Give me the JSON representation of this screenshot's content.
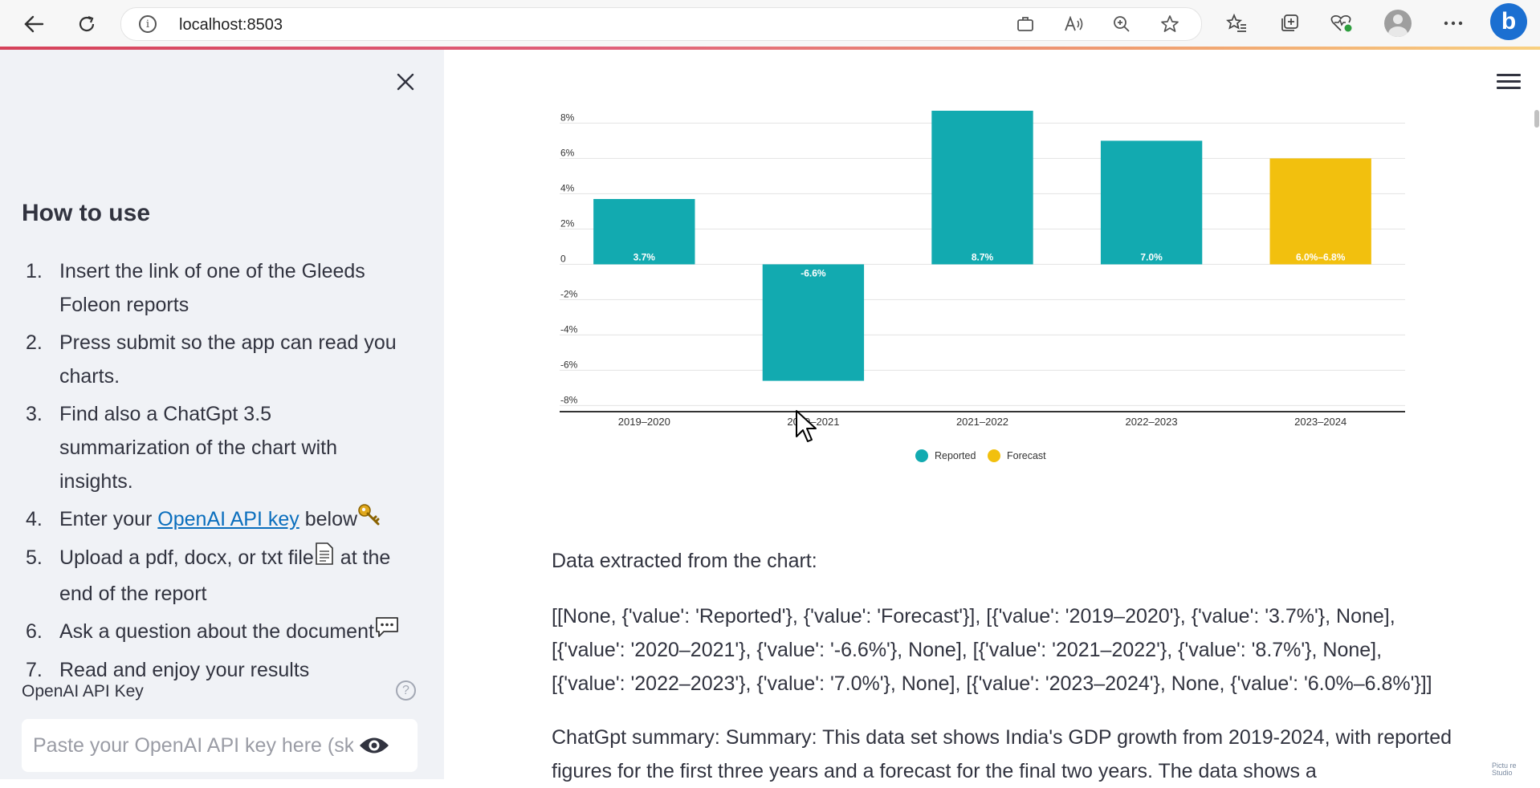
{
  "browser": {
    "url": "localhost:8503"
  },
  "sidebar": {
    "title": "How to use",
    "steps": [
      {
        "num": "1.",
        "text": "Insert the link of one of the Gleeds Foleon reports"
      },
      {
        "num": "2.",
        "text": "Press submit so the app can read you charts."
      },
      {
        "num": "3.",
        "text": "Find also a ChatGpt 3.5 summarization of the chart with insights."
      },
      {
        "num": "4.",
        "pre": "Enter your ",
        "link": "OpenAI API key",
        "post": " below"
      },
      {
        "num": "5.",
        "pre": "Upload a pdf, docx, or txt file",
        "post": " at the end of the report"
      },
      {
        "num": "6.",
        "text": "Ask a question about the document"
      },
      {
        "num": "7.",
        "text": "Read and enjoy your results"
      }
    ],
    "api_key_label": "OpenAI API Key",
    "api_key_placeholder": "Paste your OpenAI API key here (sk-"
  },
  "chart_data": {
    "type": "bar",
    "categories": [
      "2019–2020",
      "2020–2021",
      "2021–2022",
      "2022–2023",
      "2023–2024"
    ],
    "values": [
      3.7,
      -6.6,
      8.7,
      7.0,
      6.0
    ],
    "value_labels": [
      "3.7%",
      "-6.6%",
      "8.7%",
      "7.0%",
      "6.0%–6.8%"
    ],
    "bar_series": [
      "Reported",
      "Reported",
      "Reported",
      "Reported",
      "Forecast"
    ],
    "series": [
      {
        "name": "Reported",
        "color": "#12aab0"
      },
      {
        "name": "Forecast",
        "color": "#f2c00e"
      }
    ],
    "y_ticks": [
      8,
      6,
      4,
      2,
      0,
      -2,
      -4,
      -6,
      -8
    ],
    "y_tick_labels": [
      "8%",
      "6%",
      "4%",
      "2%",
      "0",
      "-2%",
      "-4%",
      "-6%",
      "-8%"
    ],
    "ylim": [
      -8.3,
      8.7
    ],
    "grid": true,
    "legend_position": "bottom-center"
  },
  "main": {
    "data_heading": "Data extracted from the chart:",
    "data_lines": [
      "[[None, {'value': 'Reported'}, {'value': 'Forecast'}], [{'value': '2019–2020'}, {'value': '3.7%'}, None],",
      "[{'value': '2020–2021'}, {'value': '-6.6%'}, None], [{'value': '2021–2022'}, {'value': '8.7%'}, None],",
      "[{'value': '2022–2023'}, {'value': '7.0%'}, None], [{'value': '2023–2024'}, None, {'value': '6.0%–6.8%'}]]"
    ],
    "summary": "ChatGpt summary: Summary: This data set shows India's GDP growth from 2019-2024, with reported figures for the first three years and a forecast for the final two years. The data shows a"
  },
  "watermark": {
    "line1": "Pictu re",
    "line2": "Studio"
  }
}
